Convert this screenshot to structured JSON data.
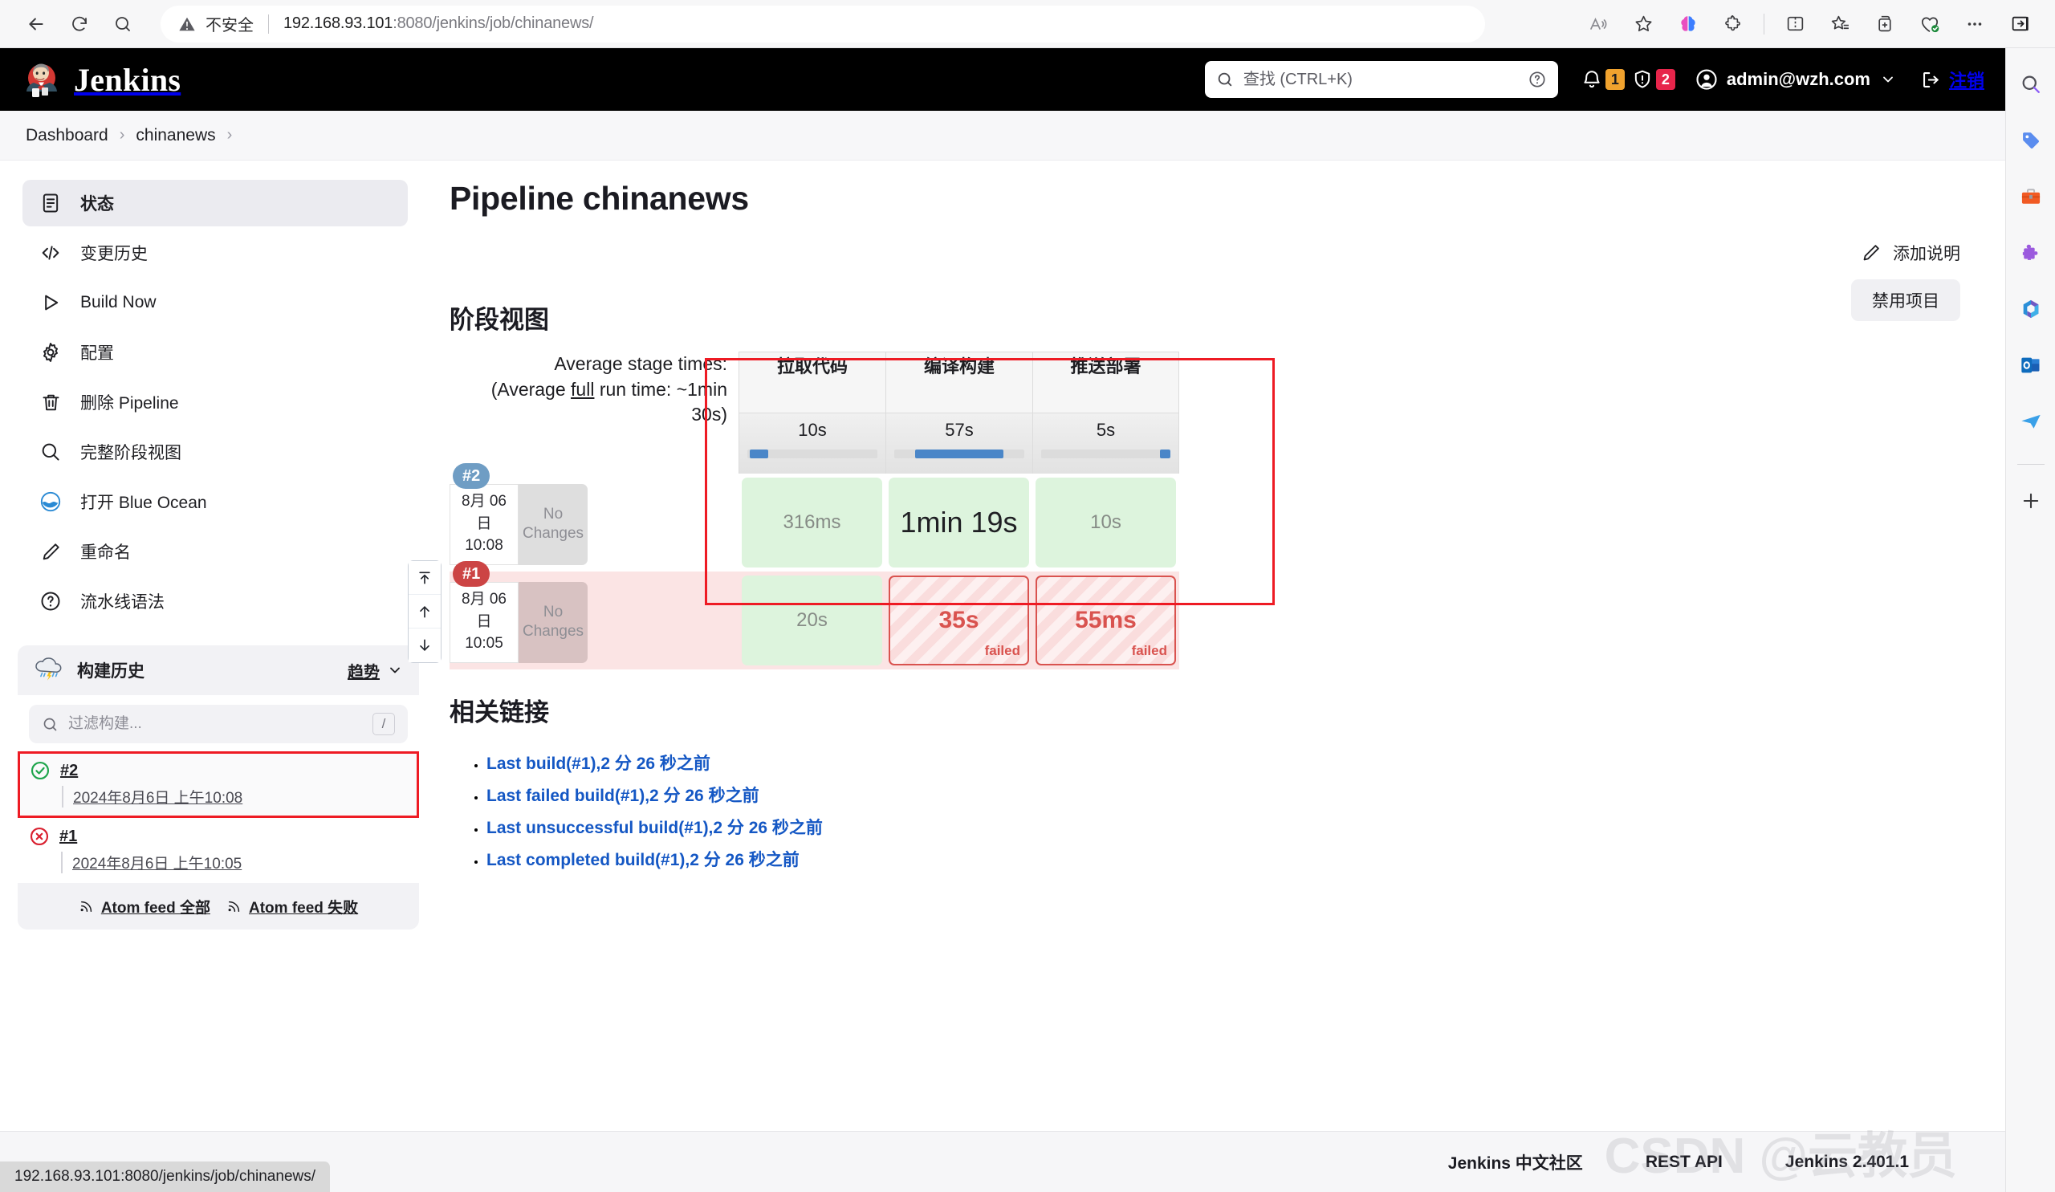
{
  "browser": {
    "back_icon": "back-arrow-icon",
    "reload_icon": "reload-icon",
    "search_icon": "search-icon",
    "security_label": "不安全",
    "url_host": "192.168.93.101",
    "url_rest": ":8080/jenkins/job/chinanews/",
    "toolbar_icons": [
      "read-aloud-icon",
      "favorite-star-icon",
      "copilot-icon",
      "extensions-icon",
      "split-screen-icon",
      "collections-icon",
      "add-tab-icon",
      "browser-essentials-icon",
      "more-options-icon",
      "sidebar-toggle-icon"
    ],
    "sidebar_icons": [
      "search-icon",
      "shopping-tag-icon",
      "tools-icon",
      "games-puzzle-icon",
      "microsoft-365-icon",
      "outlook-icon",
      "telegram-icon",
      "add-sidebar-app-icon"
    ],
    "status_url": "192.168.93.101:8080/jenkins/job/chinanews/"
  },
  "header": {
    "brand": "Jenkins",
    "logo_icon": "jenkins-butler-logo",
    "search_placeholder": "查找 (CTRL+K)",
    "search_icon": "search-icon",
    "help_icon": "help-circle-icon",
    "bell_icon": "notification-bell-icon",
    "bell_count": "1",
    "shield_icon": "security-shield-icon",
    "shield_count": "2",
    "user_icon": "user-avatar-icon",
    "user_name": "admin@wzh.com",
    "chevron_icon": "chevron-down-icon",
    "logout_icon": "logout-icon",
    "logout_label": "注销",
    "bell_badge_color": "#f0a22e",
    "shield_badge_color": "#e7254b"
  },
  "breadcrumb": {
    "items": [
      "Dashboard",
      "chinanews"
    ],
    "separator": "›"
  },
  "sidebar": {
    "items": [
      {
        "label": "状态",
        "icon": "document-status-icon",
        "active": true
      },
      {
        "label": "变更历史",
        "icon": "code-brackets-icon",
        "active": false
      },
      {
        "label": "Build Now",
        "icon": "play-triangle-icon",
        "active": false
      },
      {
        "label": "配置",
        "icon": "gear-icon",
        "active": false
      },
      {
        "label": "删除 Pipeline",
        "icon": "trash-icon",
        "active": false
      },
      {
        "label": "完整阶段视图",
        "icon": "magnifier-icon",
        "active": false
      },
      {
        "label": "打开 Blue Ocean",
        "icon": "blue-ocean-icon",
        "active": false
      },
      {
        "label": "重命名",
        "icon": "pencil-icon",
        "active": false
      },
      {
        "label": "流水线语法",
        "icon": "question-circle-icon",
        "active": false
      }
    ]
  },
  "build_history": {
    "title": "构建历史",
    "weather_icon": "storm-cloud-icon",
    "trend_label": "趋势",
    "trend_chevron": "chevron-down-icon",
    "filter_placeholder": "过滤构建...",
    "filter_value": "",
    "filter_icon": "search-icon",
    "shortcut_key": "/",
    "builds": [
      {
        "number": "#2",
        "date": "2024年8月6日 上午10:08",
        "status": "success",
        "status_icon": "check-circle-icon",
        "highlighted": true
      },
      {
        "number": "#1",
        "date": "2024年8月6日 上午10:05",
        "status": "failed",
        "status_icon": "error-circle-icon",
        "highlighted": false
      }
    ],
    "feed_all": "Atom feed 全部",
    "feed_failed": "Atom feed 失败",
    "feed_icon": "rss-icon"
  },
  "main": {
    "page_title": "Pipeline chinanews",
    "add_description": "添加说明",
    "add_description_icon": "pencil-icon",
    "disable_project": "禁用项目",
    "stage_view_heading": "阶段视图",
    "related_links_heading": "相关链接",
    "scroll_buttons": [
      "scroll-to-top-icon",
      "scroll-up-icon",
      "scroll-down-icon"
    ],
    "related_links": [
      "Last build(#1),2 分 26 秒之前",
      "Last failed build(#1),2 分 26 秒之前",
      "Last unsuccessful build(#1),2 分 26 秒之前",
      "Last completed build(#1),2 分 26 秒之前"
    ]
  },
  "stage_view": {
    "average_label_line1": "Average stage times:",
    "average_label_line2_pre": "(Average ",
    "average_label_line2_u": "full",
    "average_label_line2_post": " run time: ~1min",
    "average_label_line3": "30s)",
    "stages": [
      "拉取代码",
      "编译构建",
      "推送部署"
    ],
    "average_times": [
      "10s",
      "57s",
      "5s"
    ],
    "progress": [
      {
        "left_pct": 2,
        "width_pct": 14
      },
      {
        "left_pct": 16,
        "width_pct": 68
      },
      {
        "left_pct": 92,
        "width_pct": 8
      }
    ],
    "no_changes_label": "No Changes",
    "failed_label": "failed",
    "runs": [
      {
        "number": "#2",
        "badge_color": "#6f9dc4",
        "date_line1": "8月 06",
        "date_line2": "日",
        "date_line3": "10:08",
        "status": "success",
        "cells": [
          {
            "value": "316ms",
            "state": "ok",
            "emphasis": false
          },
          {
            "value": "1min 19s",
            "state": "ok",
            "emphasis": true
          },
          {
            "value": "10s",
            "state": "ok",
            "emphasis": false
          }
        ]
      },
      {
        "number": "#1",
        "badge_color": "#cc4444",
        "date_line1": "8月 06",
        "date_line2": "日",
        "date_line3": "10:05",
        "status": "failed",
        "cells": [
          {
            "value": "20s",
            "state": "ok",
            "emphasis": false
          },
          {
            "value": "35s",
            "state": "fail",
            "emphasis": false
          },
          {
            "value": "55ms",
            "state": "fail",
            "emphasis": false
          }
        ]
      }
    ]
  },
  "footer": {
    "links": [
      "Jenkins 中文社区",
      "REST API",
      "Jenkins 2.401.1"
    ],
    "watermark": "CSDN @云教员"
  }
}
